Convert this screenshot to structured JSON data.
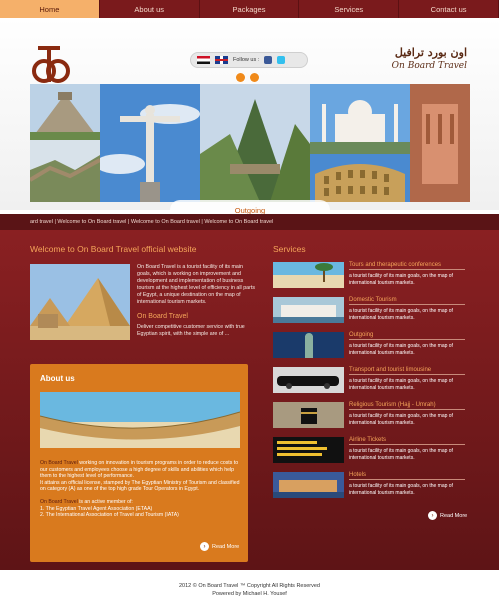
{
  "nav": {
    "items": [
      {
        "label": "Home",
        "active": true
      },
      {
        "label": "About us",
        "active": false
      },
      {
        "label": "Packages",
        "active": false
      },
      {
        "label": "Services",
        "active": false
      },
      {
        "label": "Contact us",
        "active": false
      }
    ]
  },
  "header": {
    "brand_arabic": "اون بورد ترافيل",
    "brand_english": "On Board Travel",
    "follow_label": "Follow us :",
    "slider_caption": "Outgoing"
  },
  "ticker": {
    "text": "ard travel | Welcome to On Board travel | Welcome to On Board travel | Welcome to On Board travel"
  },
  "welcome": {
    "title": "Welcome to On Board Travel official website",
    "text": "On Board Travel is a tourist facility of its main goals, which is working on improvement and development and implementation of business tourism at the highest level of efficiency in all parts of Egypt, a unique destination on the map of international tourism markets.",
    "sub_title": "On Board Travel",
    "sub_text": "Deliver competitive customer service with true Egyptian spirit, with the simple are of ..."
  },
  "about": {
    "title": "About us",
    "p1_highlight": "On Board Travel",
    "p1": " working on innovation in tourism programs in order to reduce costs to our customers and employees choose a high degree of skills and abilities which help them to the highest level of performance.",
    "p2": "It attains an official license, stamped by The Egyptian Ministry of Tourism and classified on category (A) as one of the top high grade Tour Operators in Egypt.",
    "p3_highlight": "On Board Travel",
    "p3": " is an active member of:",
    "members": [
      "1. The Egyptian Travel Agent Association (ETAA)",
      "2. The International Association of Travel and Tourism (IATA)"
    ],
    "read_more": "Read More"
  },
  "services": {
    "title": "Services",
    "items": [
      {
        "title": "Tours and therapeutic conferences",
        "desc": "a tourist facility of its main goals, on the map of international tourism markets."
      },
      {
        "title": "Domestic Tourism",
        "desc": "a tourist facility of its main goals, on the map of international tourism markets."
      },
      {
        "title": "Outgoing",
        "desc": "a tourist facility of its main goals, on the map of international tourism markets."
      },
      {
        "title": "Transport and tourist limousine",
        "desc": "a tourist facility of its main goals, on the map of international tourism markets."
      },
      {
        "title": "Religious Tourism (Hajj - Umrah)",
        "desc": "a tourist facility of its main goals, on the map of international tourism markets."
      },
      {
        "title": "Airline Tickets",
        "desc": "a tourist facility of its main goals, on the map of international tourism markets."
      },
      {
        "title": "Hotels",
        "desc": "a tourist facility of its main goals, on the map of international tourism markets."
      }
    ],
    "read_more": "Read More"
  },
  "footer": {
    "copyright": "2012 © On Board Travel ™ Copyright All Rights Reserved",
    "powered": "Powered by Michael H. Yousef"
  },
  "colors": {
    "nav_bg": "#7a1a1c",
    "nav_active": "#f5b06a",
    "main_bg": "#8a2022",
    "accent": "#f5a55a",
    "about_bg": "#d97a1e"
  }
}
